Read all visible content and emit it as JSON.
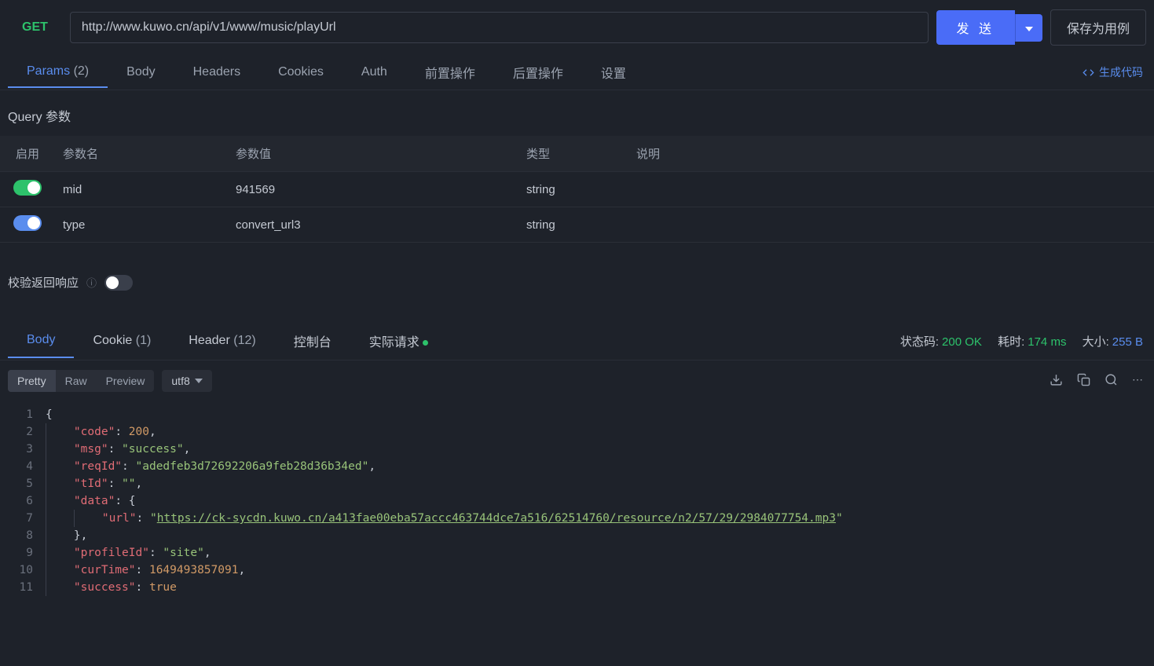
{
  "request": {
    "method": "GET",
    "url": "http://www.kuwo.cn/api/v1/www/music/playUrl",
    "send_label": "发 送",
    "save_label": "保存为用例"
  },
  "req_tabs": [
    {
      "label": "Params",
      "count": "(2)",
      "active": true
    },
    {
      "label": "Body"
    },
    {
      "label": "Headers"
    },
    {
      "label": "Cookies"
    },
    {
      "label": "Auth"
    },
    {
      "label": "前置操作"
    },
    {
      "label": "后置操作"
    },
    {
      "label": "设置"
    }
  ],
  "gen_code_label": "生成代码",
  "query_section_title": "Query 参数",
  "params_headers": {
    "enable": "启用",
    "name": "参数名",
    "value": "参数值",
    "type": "类型",
    "desc": "说明"
  },
  "params": [
    {
      "enabled": true,
      "toggle_color": "green",
      "name": "mid",
      "value": "941569",
      "type": "string",
      "desc": ""
    },
    {
      "enabled": true,
      "toggle_color": "blue",
      "name": "type",
      "value": "convert_url3",
      "type": "string",
      "desc": ""
    }
  ],
  "validate_label": "校验返回响应",
  "resp_tabs": [
    {
      "label": "Body",
      "active": true
    },
    {
      "label": "Cookie",
      "count": "(1)"
    },
    {
      "label": "Header",
      "count": "(12)"
    },
    {
      "label": "控制台"
    },
    {
      "label": "实际请求",
      "dot": true
    }
  ],
  "status": {
    "code_label": "状态码:",
    "code": "200 OK",
    "time_label": "耗时:",
    "time": "174 ms",
    "size_label": "大小:",
    "size": "255 B"
  },
  "view_modes": {
    "pretty": "Pretty",
    "raw": "Raw",
    "preview": "Preview"
  },
  "encoding": "utf8",
  "response_body": {
    "code": 200,
    "msg": "success",
    "reqId": "adedfeb3d72692206a9feb28d36b34ed",
    "tId": "",
    "data": {
      "url": "https://ck-sycdn.kuwo.cn/a413fae00eba57accc463744dce7a516/62514760/resource/n2/57/29/2984077754.mp3"
    },
    "profileId": "site",
    "curTime": 1649493857091,
    "success": true
  }
}
